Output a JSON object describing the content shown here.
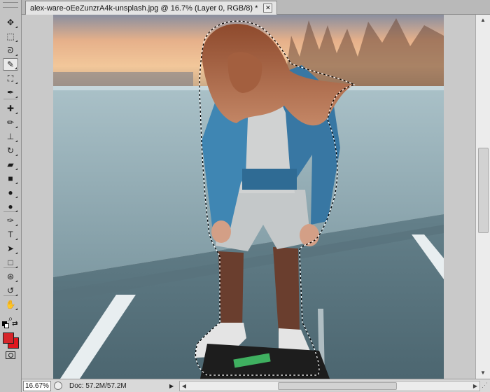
{
  "document": {
    "tab_title": "alex-ware-oEeZunzrA4k-unsplash.jpg @ 16.7% (Layer 0, RGB/8) *",
    "close_glyph": "✕"
  },
  "tools": [
    {
      "name": "move-tool",
      "icon": "move-icon",
      "glyph": "✥"
    },
    {
      "name": "marquee-tool",
      "icon": "rect-marquee-icon",
      "glyph": "⬚"
    },
    {
      "name": "lasso-tool",
      "icon": "lasso-icon",
      "glyph": "ᘐ"
    },
    {
      "name": "quick-selection-tool",
      "icon": "quick-selection-icon",
      "glyph": "✎"
    },
    {
      "name": "crop-tool",
      "icon": "crop-icon",
      "glyph": "⛶"
    },
    {
      "name": "eyedropper-tool",
      "icon": "eyedropper-icon",
      "glyph": "✒"
    },
    {
      "name": "healing-brush-tool",
      "icon": "bandage-icon",
      "glyph": "✚"
    },
    {
      "name": "brush-tool",
      "icon": "brush-icon",
      "glyph": "✏"
    },
    {
      "name": "clone-stamp-tool",
      "icon": "stamp-icon",
      "glyph": "⊥"
    },
    {
      "name": "history-brush-tool",
      "icon": "history-brush-icon",
      "glyph": "↻"
    },
    {
      "name": "eraser-tool",
      "icon": "eraser-icon",
      "glyph": "▰"
    },
    {
      "name": "gradient-tool",
      "icon": "gradient-icon",
      "glyph": "■"
    },
    {
      "name": "blur-tool",
      "icon": "droplet-icon",
      "glyph": "●"
    },
    {
      "name": "dodge-tool",
      "icon": "dodge-icon",
      "glyph": "●"
    },
    {
      "name": "pen-tool",
      "icon": "pen-icon",
      "glyph": "✑"
    },
    {
      "name": "type-tool",
      "icon": "type-icon",
      "glyph": "T"
    },
    {
      "name": "path-selection-tool",
      "icon": "arrow-pointer-icon",
      "glyph": "➤"
    },
    {
      "name": "shape-tool",
      "icon": "rectangle-shape-icon",
      "glyph": "□"
    },
    {
      "name": "3d-rotate-tool",
      "icon": "3d-rotate-icon",
      "glyph": "⊛"
    },
    {
      "name": "3d-orbit-tool",
      "icon": "3d-orbit-icon",
      "glyph": "↺"
    },
    {
      "name": "hand-tool",
      "icon": "hand-icon",
      "glyph": "✋"
    },
    {
      "name": "zoom-tool",
      "icon": "magnifier-icon",
      "glyph": "⌕"
    }
  ],
  "active_tool": "quick-selection-tool",
  "colors": {
    "foreground": "#d7262b",
    "background": "#e0161d",
    "accent_blue": "#3f86b3"
  },
  "status": {
    "zoom": "16.67%",
    "doc_info": "Doc: 57.2M/57.2M",
    "menu_glyph": "▶"
  },
  "scroll": {
    "up": "▲",
    "down": "▼",
    "left": "◀",
    "right": "▶"
  }
}
